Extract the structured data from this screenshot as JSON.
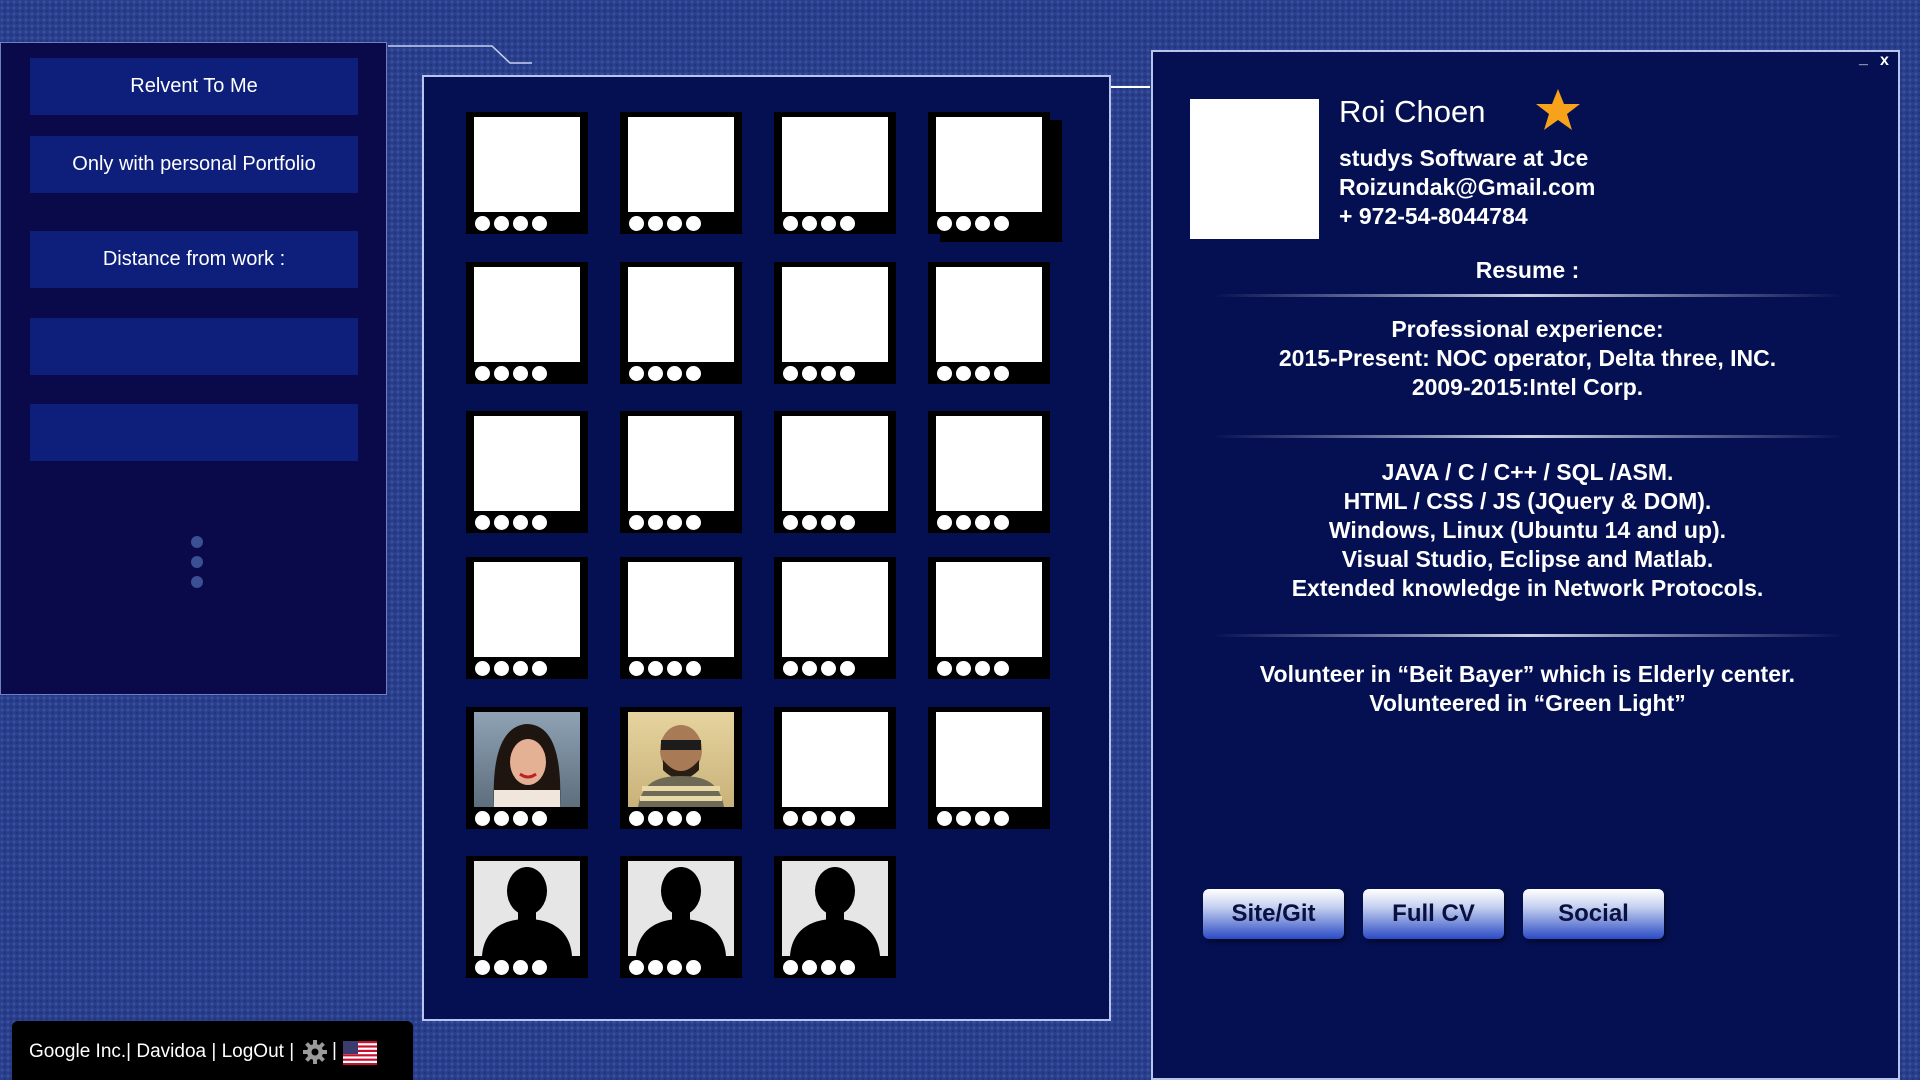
{
  "filters": {
    "items": [
      {
        "label": "Relvent To Me"
      },
      {
        "label": "Only with personal Portfolio"
      },
      {
        "label": "Distance from work :"
      },
      {
        "label": ""
      },
      {
        "label": ""
      }
    ]
  },
  "grid": {
    "cards": [
      {
        "photo": "blank"
      },
      {
        "photo": "blank"
      },
      {
        "photo": "blank"
      },
      {
        "photo": "blank"
      },
      {
        "photo": "blank"
      },
      {
        "photo": "blank"
      },
      {
        "photo": "blank"
      },
      {
        "photo": "blank"
      },
      {
        "photo": "blank"
      },
      {
        "photo": "blank"
      },
      {
        "photo": "blank"
      },
      {
        "photo": "blank"
      },
      {
        "photo": "blank"
      },
      {
        "photo": "blank"
      },
      {
        "photo": "blank"
      },
      {
        "photo": "blank"
      },
      {
        "photo": "woman-photo"
      },
      {
        "photo": "man-photo"
      },
      {
        "photo": "blank"
      },
      {
        "photo": "blank"
      },
      {
        "photo": "silhouette"
      },
      {
        "photo": "silhouette"
      },
      {
        "photo": "silhouette"
      }
    ]
  },
  "profile": {
    "minimize_label": "_",
    "close_label": "x",
    "name": "Roi Choen",
    "study": "studys Software at Jce",
    "email": "Roizundak@Gmail.com",
    "phone": "+ 972-54-8044784",
    "resume_heading": "Resume :",
    "experience": [
      "Professional  experience:",
      "2015-Present: NOC operator, Delta three, INC.",
      "2009-2015:Intel Corp."
    ],
    "skills": [
      "JAVA / C / C++ / SQL /ASM.",
      "HTML / CSS / JS (JQuery & DOM).",
      "Windows, Linux (Ubuntu 14 and up).",
      "Visual Studio, Eclipse and Matlab.",
      "Extended knowledge in Network Protocols."
    ],
    "volunteer": [
      "Volunteer in “Beit Bayer” which is Elderly center.",
      "Volunteered  in “Green Light”"
    ],
    "buttons": {
      "site": "Site/Git",
      "cv": "Full CV",
      "social": "Social"
    }
  },
  "footer": {
    "text": "Google Inc.| Davidoa  | LogOut  |",
    "separator": "|"
  },
  "colors": {
    "accent_star": "#f7a21b",
    "panel_bg": "#051052"
  }
}
